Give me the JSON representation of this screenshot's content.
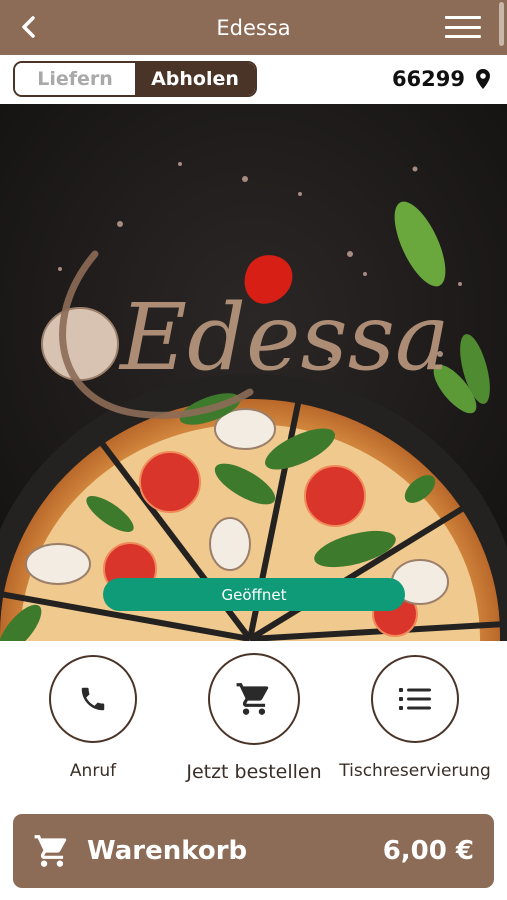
{
  "header": {
    "title": "Edessa",
    "back_icon": "chevron-left-icon",
    "menu_icon": "hamburger-menu-icon"
  },
  "order_mode": {
    "options": [
      "Liefern",
      "Abholen"
    ],
    "selected": "Abholen"
  },
  "location": {
    "zip": "66299",
    "icon": "map-pin-icon"
  },
  "hero": {
    "logo_text": "Edessa",
    "status_label": "Geöffnet"
  },
  "actions": [
    {
      "label": "Anruf",
      "icon": "phone-icon"
    },
    {
      "label": "Jetzt bestellen",
      "icon": "cart-icon"
    },
    {
      "label": "Tischreservierung",
      "icon": "list-icon"
    }
  ],
  "cart": {
    "label": "Warenkorb",
    "total": "6,00 €",
    "icon": "cart-icon"
  },
  "colors": {
    "brand_brown": "#8c6b57",
    "dark_brown": "#4a3428",
    "status_green": "#0f9a78"
  }
}
